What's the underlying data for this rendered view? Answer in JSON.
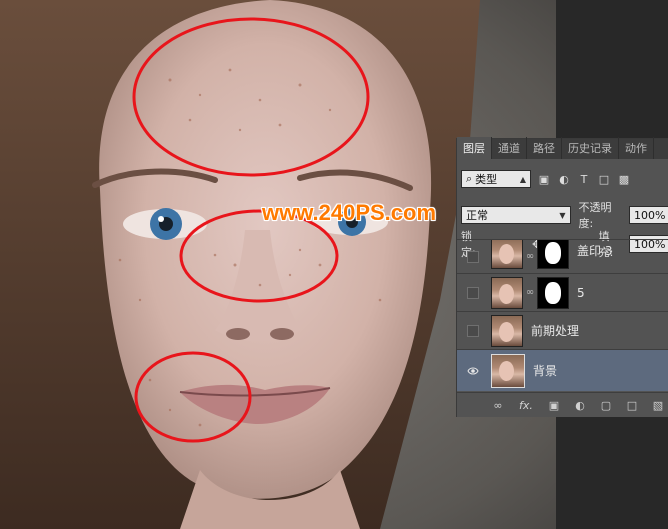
{
  "watermark": "www.240PS.com",
  "panel": {
    "tabs": [
      "图层",
      "通道",
      "路径",
      "历史记录",
      "动作"
    ],
    "filter_kind": "类型",
    "blend_mode": "正常",
    "opacity_label": "不透明度:",
    "opacity_value": "100%",
    "lock_label": "锁定:",
    "fill_label": "填充:",
    "fill_value": "100%",
    "layers": [
      {
        "name": "盖印 3",
        "visible": false,
        "has_mask": true,
        "selected": false
      },
      {
        "name": "5",
        "visible": false,
        "has_mask": true,
        "selected": false
      },
      {
        "name": "前期处理",
        "visible": false,
        "has_mask": false,
        "selected": false
      },
      {
        "name": "背景",
        "visible": true,
        "has_mask": false,
        "selected": true
      }
    ],
    "bottom_icons": [
      "link-icon",
      "fx-icon",
      "add-mask-icon",
      "adjustment-icon",
      "group-icon",
      "new-layer-icon",
      "delete-icon"
    ],
    "fx_label": "fx."
  },
  "colors": {
    "annotation_circle": "#e8151b",
    "watermark": "#ff7a00",
    "selected_layer": "#5d6a7e"
  }
}
